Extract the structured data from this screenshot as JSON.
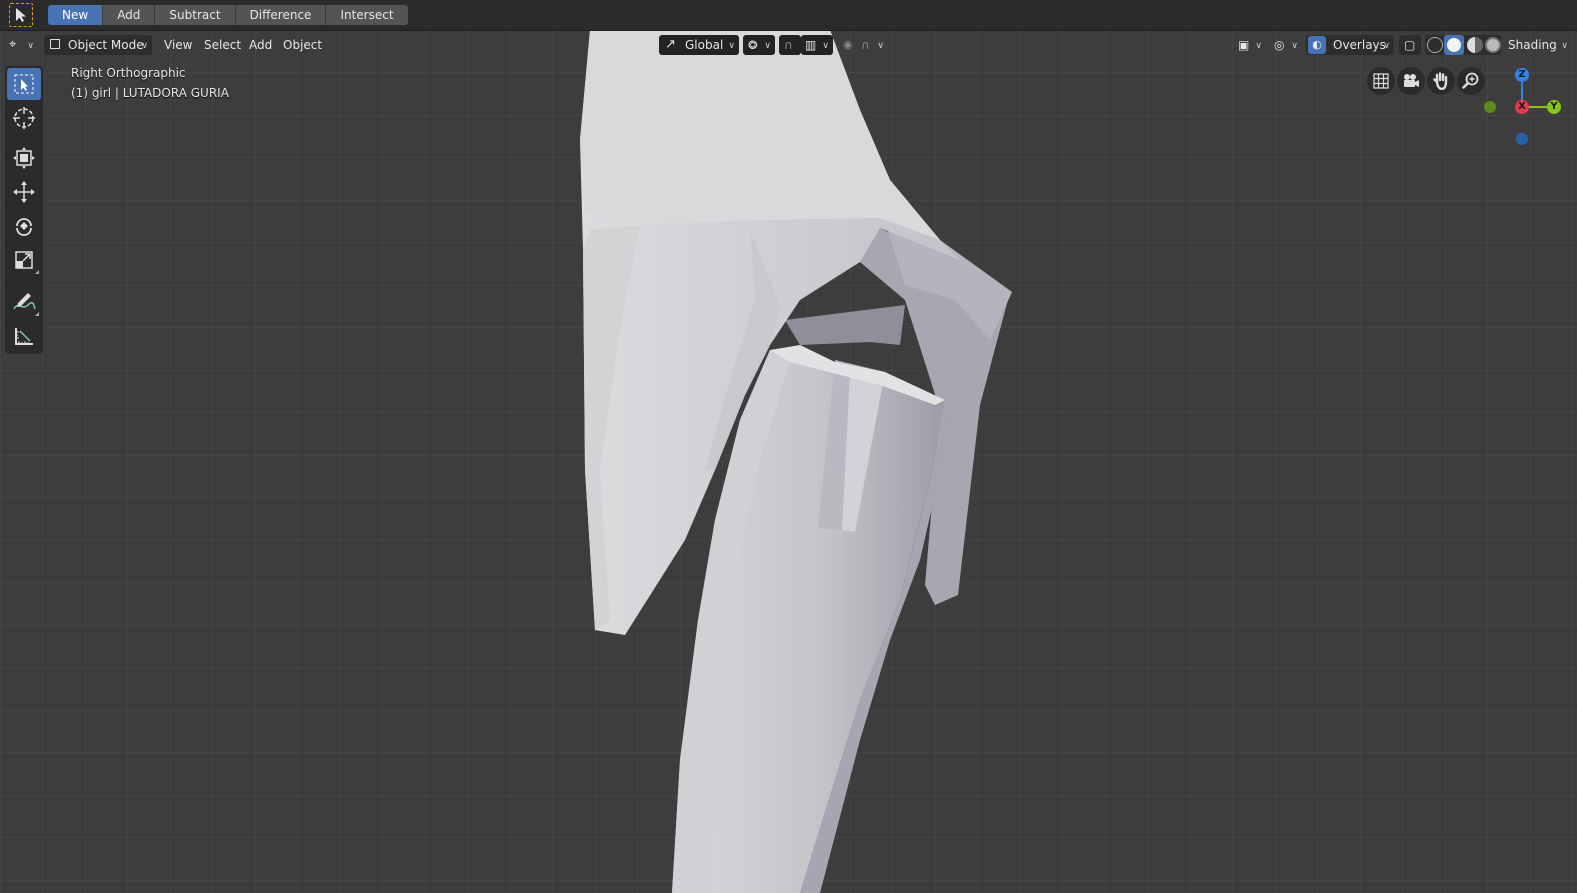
{
  "tool_header": {
    "boolean_buttons": [
      {
        "label": "New",
        "active": true
      },
      {
        "label": "Add",
        "active": false
      },
      {
        "label": "Subtract",
        "active": false
      },
      {
        "label": "Difference",
        "active": false
      },
      {
        "label": "Intersect",
        "active": false
      }
    ]
  },
  "viewport_header": {
    "mode": "Object Mode",
    "menus": [
      "View",
      "Select",
      "Add",
      "Object"
    ],
    "transform_orientation": "Global",
    "overlays_label": "Overlays",
    "shading_label": "Shading"
  },
  "viewport": {
    "view_name": "Right Orthographic",
    "object_info": "(1) girl | LUTADORA GURIA"
  },
  "gizmo": {
    "z": "Z",
    "x": "X",
    "y": "Y"
  },
  "toolbar": {
    "tools": [
      "select-box",
      "cursor",
      "transform",
      "move",
      "rotate",
      "scale",
      "annotate",
      "measure"
    ],
    "active_tool": "select-box"
  },
  "colors": {
    "accent": "#4772b3",
    "axis_x": "#e23b50",
    "axis_y": "#84c41c",
    "axis_z": "#2f85e6",
    "grid": "#474747",
    "background": "#3d3d3d",
    "mesh": "#c9c9ce"
  }
}
